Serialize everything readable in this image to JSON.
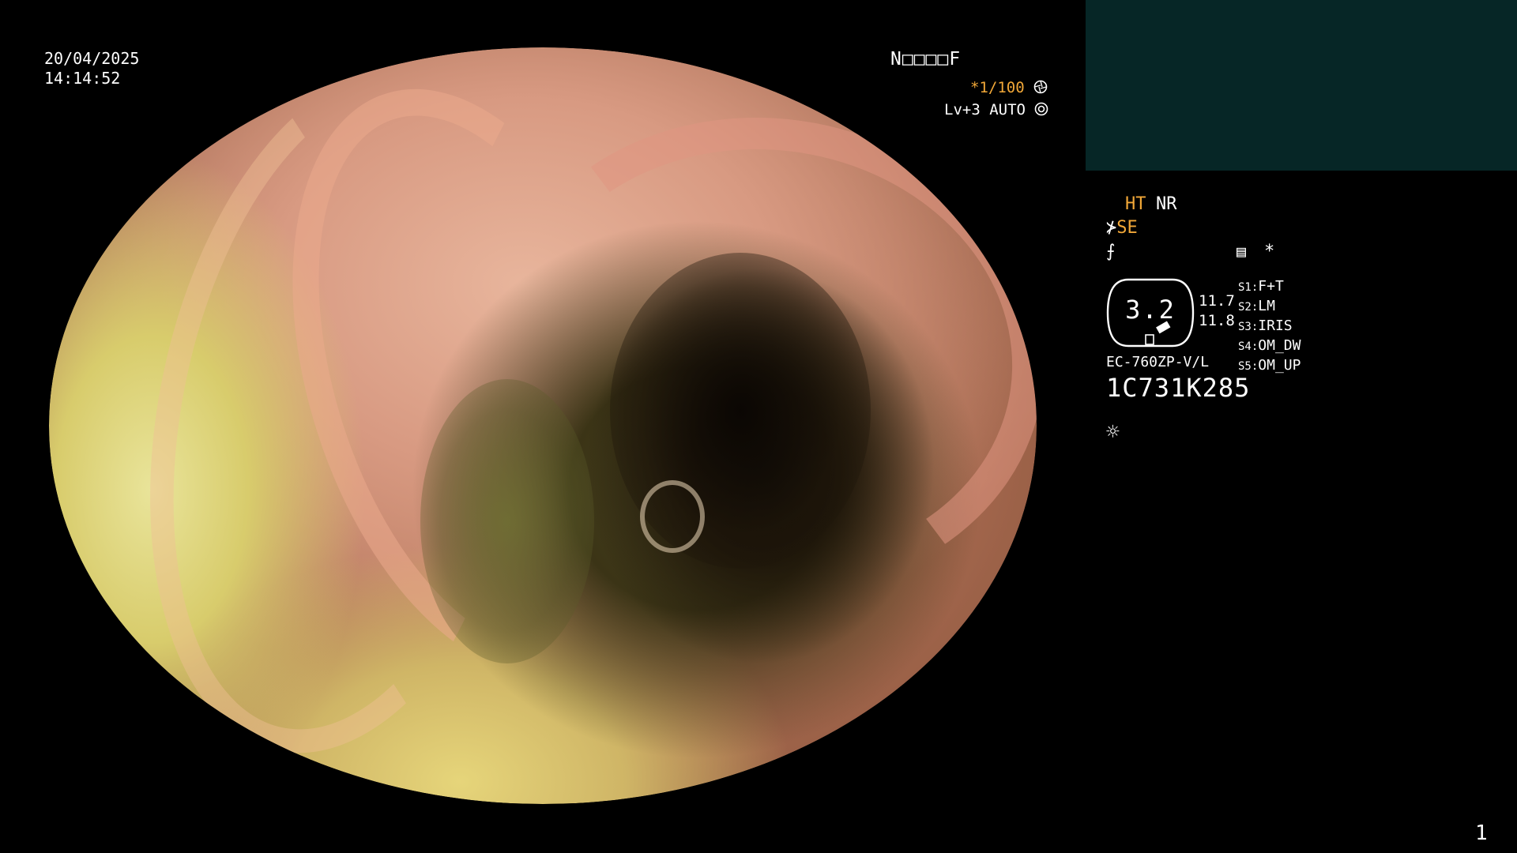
{
  "header": {
    "date": "20/04/2025",
    "time": "14:14:52",
    "serial_label": "N□□□□F",
    "shutter": "*1/100",
    "shutter_icon": "aperture-icon",
    "level": "Lv+3 AUTO",
    "level_icon": "auto-iris-icon"
  },
  "panel": {
    "ht": "HT",
    "nr": "NR",
    "se_prefix": "⊁",
    "se": "SE",
    "f_icon": "f-slash-icon",
    "f_glyph": "⨍",
    "menu_glyph": "▤",
    "star": "*",
    "gauge_value": "3.2",
    "gauge_top": "11.7",
    "gauge_bottom": "11.8",
    "switches": [
      {
        "key": "S1:",
        "value": "F+T"
      },
      {
        "key": "S2:",
        "value": "LM"
      },
      {
        "key": "S3:",
        "value": "IRIS"
      },
      {
        "key": "S4:",
        "value": "OM_DW"
      },
      {
        "key": "S5:",
        "value": "OM_UP"
      }
    ],
    "model": "EC-760ZP-V/L",
    "scope_id": "1C731K285",
    "sun_glyph": "☼"
  },
  "footer": {
    "page_number": "1"
  },
  "colors": {
    "accent_amber": "#f2a838",
    "teal_box": "#062626",
    "background": "#000000"
  }
}
